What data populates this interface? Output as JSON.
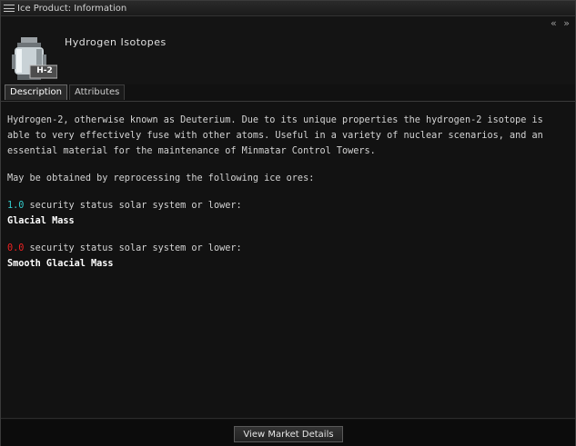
{
  "window": {
    "title": "Ice Product: Information",
    "collapse_glyph": "« »"
  },
  "item": {
    "name": "Hydrogen Isotopes",
    "icon_label": "H-2"
  },
  "tabs": [
    {
      "label": "Description",
      "active": true
    },
    {
      "label": "Attributes",
      "active": false
    }
  ],
  "description": {
    "paragraph": "Hydrogen-2, otherwise known as Deuterium. Due to its unique properties the hydrogen-2 isotope is able to very effectively fuse with other atoms. Useful in a variety of nuclear scenarios, and an essential material for the maintenance of Minmatar Control Towers.",
    "obtain_text": "May be obtained by reprocessing the following ice ores:",
    "ores": [
      {
        "sec_value": "1.0",
        "sec_suffix": " security status solar system or lower:",
        "ore_name": "Glacial Mass",
        "sec_color": "#33cccc"
      },
      {
        "sec_value": "0.0",
        "sec_suffix": " security status solar system or lower:",
        "ore_name": "Smooth Glacial Mass",
        "sec_color": "#ee2222"
      }
    ]
  },
  "footer": {
    "market_button": "View Market Details"
  }
}
